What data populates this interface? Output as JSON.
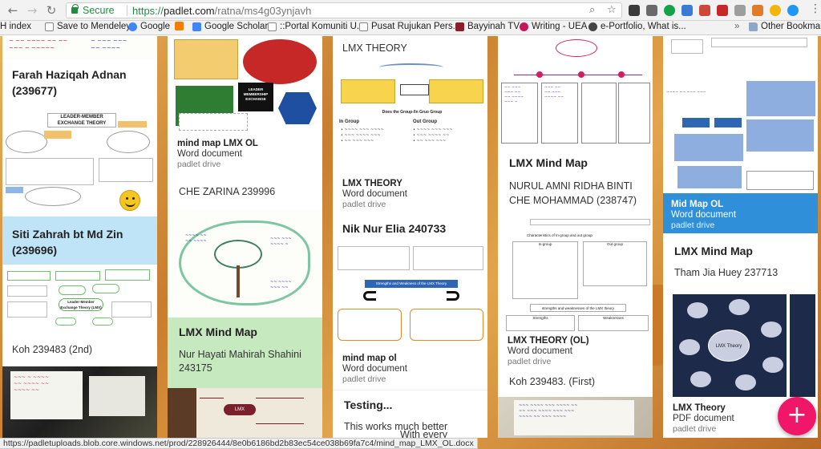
{
  "browser": {
    "secure_label": "Secure",
    "url_scheme": "https://",
    "url_host": "padlet.com",
    "url_path": "/ratna/ms4g03ynjavh",
    "bookmarks": [
      "H index",
      "Save to Mendeley",
      "Google",
      "Google Scholar",
      "::Portal Komuniti U...",
      "Pusat Rujukan Pers...",
      "Bayyinah TV",
      "Writing - UEA",
      "e-Portfolio, What is...",
      "Other Bookmarks"
    ],
    "status_url": "https://padletuploads.blob.core.windows.net/prod/228926444/8e0b6186bd2b83ec54ce038b69fa7c4/mind_map_LMX_OL.docx"
  },
  "colors": {
    "accent": "#f0176a",
    "blue_card": "#bfe3f7",
    "green_card": "#c7e9c0",
    "mid_map_blue": "#2f8fd8",
    "secure_green": "#1e8e3e"
  },
  "fab_label": "+",
  "col1": {
    "card1_title": "Farah Haziqah Adnan (239677)",
    "card1_diagram_title": "LEADER-MEMBER EXCHANGE THEORY",
    "card2_title": "Siti Zahrah bt Md Zin (239696)",
    "card2_diagram_center": "Leader-Member Exchange Theory (LMX)",
    "card3_text": "Koh 239483 (2nd)"
  },
  "col2": {
    "card1_title": "mind map LMX OL",
    "card1_type": "Word document",
    "card1_source": "padlet drive",
    "card1_center": "LEADER MEMBERSHIP EXCHANGE",
    "card2_text": "CHE ZARINA 239996",
    "card3_title": "LMX Mind Map",
    "card3_text": "Nur Hayati Mahirah Shahini 243175",
    "card4_center": "LMX"
  },
  "col3": {
    "card1_title": "LMX THEORY",
    "card1_subtitle": "LMX THEORY",
    "card1_type": "Word document",
    "card1_source": "padlet drive",
    "card1_in_group": "In Group",
    "card1_out_group": "Out Group",
    "card1_diagram_caption": "Does the Group-/In Gruo Group",
    "card2_title": "Nik Nur Elia 240733",
    "card2_banner": "Strengths and Weakness of the LMX Theory",
    "card2_type_title": "mind map ol",
    "card2_type": "Word document",
    "card2_source": "padlet drive",
    "card3_title": "Testing...",
    "card3_text1": "This works much better",
    "card3_text2": "With every"
  },
  "col4": {
    "card1_title": "LMX Mind Map",
    "card1_text": "NURUL AMNI RIDHA BINTI CHE MOHAMMAD (238747)",
    "card1_caption": "Characteristics of In-group and out group",
    "card1_ingroup": "In-group",
    "card1_outgroup": "Out group",
    "card1_strengths_head": "strengths and weaknesses of the LMX theory",
    "card1_strengths": "Strengths",
    "card1_weaknesses": "Weaknesses",
    "card2_title": "LMX THEORY (OL)",
    "card2_type": "Word document",
    "card2_source": "padlet drive",
    "card3_text": "Koh 239483. (First)"
  },
  "col5": {
    "card1_title": "Mid Map OL",
    "card1_type": "Word document",
    "card1_source": "padlet drive",
    "card2_title": "LMX Mind Map",
    "card2_text": "Tham Jia Huey 237713",
    "card2_center": "LMX Theory",
    "card3_title": "LMX Theory",
    "card3_type": "PDF document",
    "card3_source": "padlet drive"
  }
}
